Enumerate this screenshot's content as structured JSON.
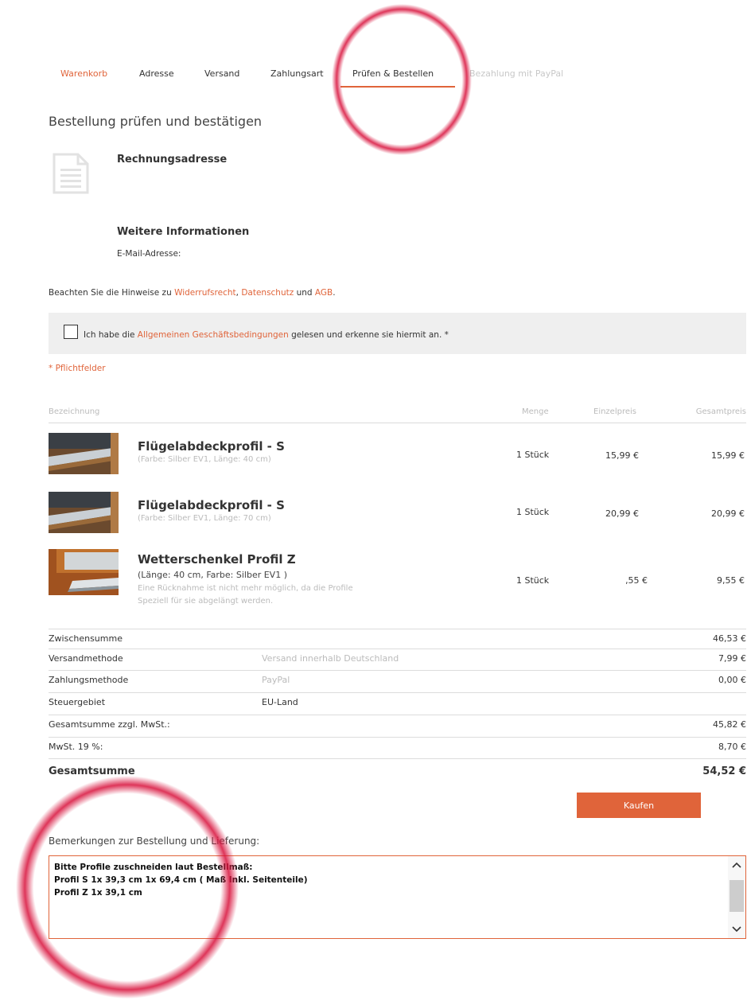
{
  "tabs": [
    {
      "label": "Warenkorb"
    },
    {
      "label": "Adresse"
    },
    {
      "label": "Versand"
    },
    {
      "label": "Zahlungsart"
    },
    {
      "label": "Prüfen & Bestellen"
    },
    {
      "label": "Bezahlung mit PayPal"
    }
  ],
  "page_title": "Bestellung prüfen und bestätigen",
  "billing": {
    "heading": "Rechnungsadresse"
  },
  "more_info": {
    "heading": "Weitere Informationen",
    "email_label": "E-Mail-Adresse:"
  },
  "notice": {
    "prefix": "Beachten Sie die Hinweise zu ",
    "withdrawal": "Widerrufsrecht",
    "comma": ", ",
    "privacy": "Datenschutz",
    "and": " und ",
    "terms": "AGB",
    "end": "."
  },
  "agb": {
    "prefix": "Ich habe die ",
    "link": "Allgemeinen Geschäftsbedingungen",
    "suffix": " gelesen und erkenne sie hiermit an. *"
  },
  "required_note": "* Pflichtfelder",
  "table": {
    "headers": {
      "name": "Bezeichnung",
      "qty": "Menge",
      "unit": "Einzelpreis",
      "total": "Gesamtpreis"
    },
    "products": [
      {
        "name": "Flügelabdeckprofil - S",
        "options": "(Farbe: Silber EV1, Länge: 40 cm)",
        "qty": "1 Stück",
        "unit": "15,99 €",
        "total": "15,99 €"
      },
      {
        "name": "Flügelabdeckprofil - S",
        "options": "(Farbe: Silber EV1, Länge: 70 cm)",
        "qty": "1 Stück",
        "unit": "20,99 €",
        "total": "20,99 €"
      },
      {
        "name": "Wetterschenkel Profil Z",
        "options": "(Länge: 40 cm, Farbe: Silber EV1 )",
        "note1": "Eine Rücknahme ist nicht mehr möglich, da die Profile",
        "note2": "Speziell für sie abgelängt werden.",
        "qty": "1 Stück",
        "unit": "‚55 €",
        "total": "9,55 €"
      }
    ]
  },
  "summary": {
    "subtotal": {
      "label": "Zwischensumme",
      "value": "46,53 €"
    },
    "shipping": {
      "label": "Versandmethode",
      "detail": "Versand innerhalb Deutschland",
      "value": "7,99 €"
    },
    "payment": {
      "label": "Zahlungsmethode",
      "detail": "PayPal",
      "value": "0,00 €"
    },
    "tax_region": {
      "label": "Steuergebiet",
      "detail": "EU-Land"
    },
    "net": {
      "label": "Gesamtsumme zzgl. MwSt.:",
      "value": "45,82 €"
    },
    "vat": {
      "label": "MwSt. 19 %:",
      "value": "8,70 €"
    },
    "grand": {
      "label": "Gesamtsumme",
      "value": "54,52 €"
    }
  },
  "buy_label": "Kaufen",
  "remarks": {
    "label": "Bemerkungen zur Bestellung und Lieferung:",
    "value": "Bitte Profile zuschneiden laut Bestellmaß:\nProfil S 1x 39,3 cm 1x 69,4 cm ( Maß Inkl. Seitenteile)\nProfil Z 1x 39,1 cm"
  },
  "colors": {
    "accent": "#e0643a",
    "ring": "#d8123c"
  },
  "icons": [
    "document-icon",
    "chevron-up-icon",
    "chevron-down-icon"
  ]
}
